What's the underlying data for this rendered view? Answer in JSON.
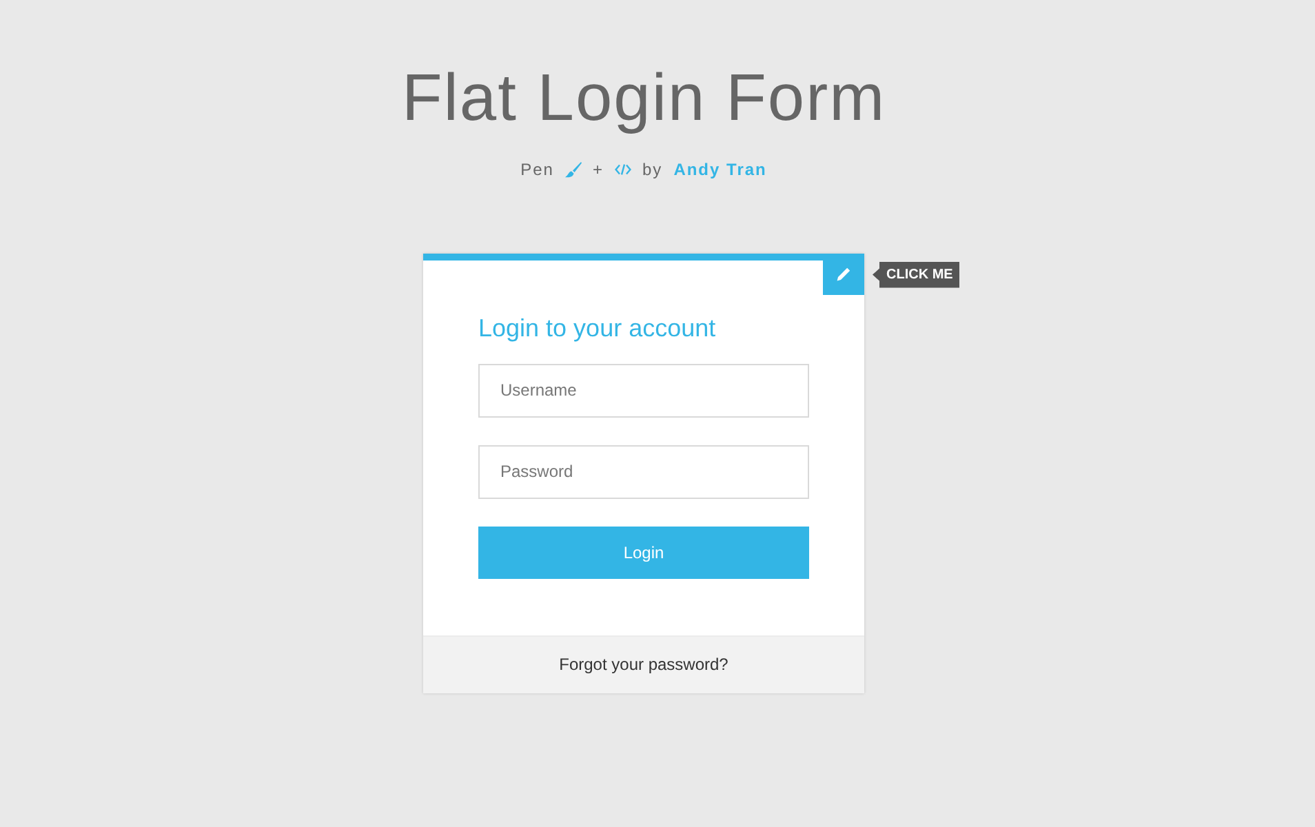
{
  "header": {
    "title": "Flat Login Form",
    "credit": {
      "prefix": "Pen",
      "joiner": "+",
      "by": "by",
      "author": "Andy Tran"
    }
  },
  "card": {
    "toggle_tooltip": "CLICK ME",
    "heading": "Login to your account",
    "fields": [
      {
        "placeholder": "Username"
      },
      {
        "placeholder": "Password"
      }
    ],
    "button": "Login",
    "footer_link": "Forgot your password?"
  }
}
